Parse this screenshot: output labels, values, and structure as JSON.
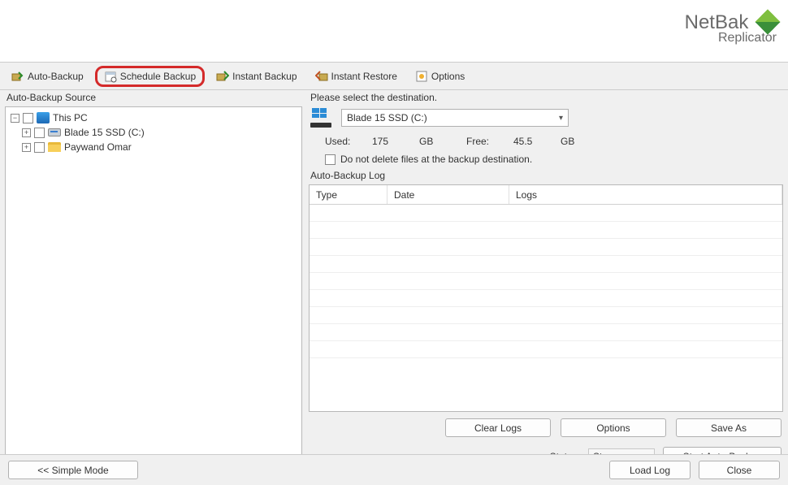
{
  "logo": {
    "line1a": "Net",
    "line1b": "Bak",
    "line2": "Replicator"
  },
  "toolbar": {
    "auto_backup": "Auto-Backup",
    "schedule_backup": "Schedule Backup",
    "instant_backup": "Instant Backup",
    "instant_restore": "Instant Restore",
    "options": "Options"
  },
  "left": {
    "title": "Auto-Backup Source",
    "tree": {
      "root": "This PC",
      "child1": "Blade 15 SSD (C:)",
      "child2": "Paywand Omar"
    }
  },
  "right": {
    "dest_label": "Please select the destination.",
    "dest_selected": "Blade 15 SSD (C:)",
    "usage": {
      "used_label": "Used:",
      "used_val": "175",
      "used_unit": "GB",
      "free_label": "Free:",
      "free_val": "45.5",
      "free_unit": "GB"
    },
    "dnd_label": "Do not delete files at the backup destination.",
    "log_title": "Auto-Backup Log",
    "cols": {
      "type": "Type",
      "date": "Date",
      "logs": "Logs"
    },
    "buttons": {
      "clear_logs": "Clear Logs",
      "options": "Options",
      "save_as": "Save As"
    },
    "status_label": "Status:",
    "status_value": "Stop",
    "start_button": "Start Auto-Backup"
  },
  "bottom": {
    "simple_mode": "<< Simple Mode",
    "load_log": "Load Log",
    "close": "Close"
  }
}
